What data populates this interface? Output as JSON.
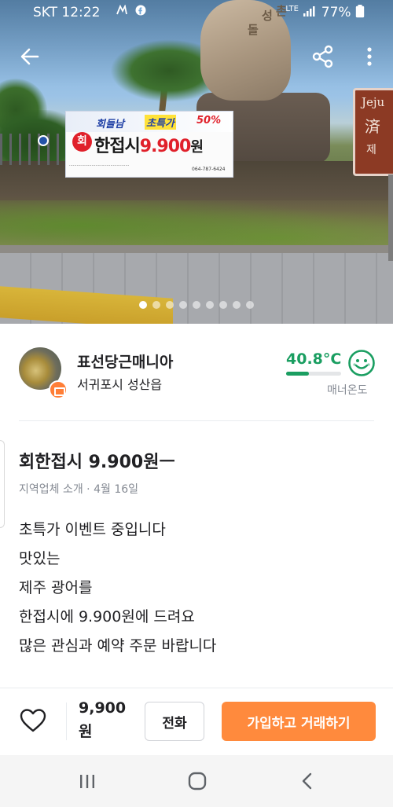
{
  "status_bar": {
    "carrier": "SKT",
    "time": "12:22",
    "network": "LTE",
    "battery": "77%"
  },
  "banner": {
    "line1_a": "회들남",
    "line1_b": "초특가",
    "line1_c": "50%",
    "badge": "회",
    "main_text": "한접시",
    "main_price": "9.900",
    "main_unit": "원",
    "phone": "064-787-6424"
  },
  "jeju_sign": {
    "line1": "Jeju",
    "line2": "済",
    "line3": "제"
  },
  "carousel": {
    "total": 9,
    "active_index": 0
  },
  "seller": {
    "nickname": "표선당근매니아",
    "location": "서귀포시 성산읍",
    "manner_temp": "40.8°C",
    "manner_temp_fill": 0.41,
    "manner_label": "매너온도"
  },
  "post": {
    "title": "회한접시 9.900원ㅡ",
    "meta": "지역업체 소개 · 4월 16일",
    "body_lines": [
      "초특가 이벤트 중입니다",
      "맛있는",
      "제주 광어를",
      "한접시에 9.900원에 드려요",
      "많은 관심과 예약 주문 바랍니다"
    ]
  },
  "actions": {
    "price_line1": "9,900",
    "price_line2": "원",
    "call_label": "전화",
    "join_label": "가입하고 거래하기"
  },
  "colors": {
    "accent": "#ff8a3d",
    "temp_green": "#1a9e61",
    "text": "#212124",
    "muted": "#868b94"
  },
  "icons": {
    "back": "back-arrow-icon",
    "share": "share-icon",
    "more": "more-vertical-icon",
    "like": "heart-icon",
    "nav_recent": "recent-apps-icon",
    "nav_home": "home-icon",
    "nav_back": "nav-back-icon"
  }
}
